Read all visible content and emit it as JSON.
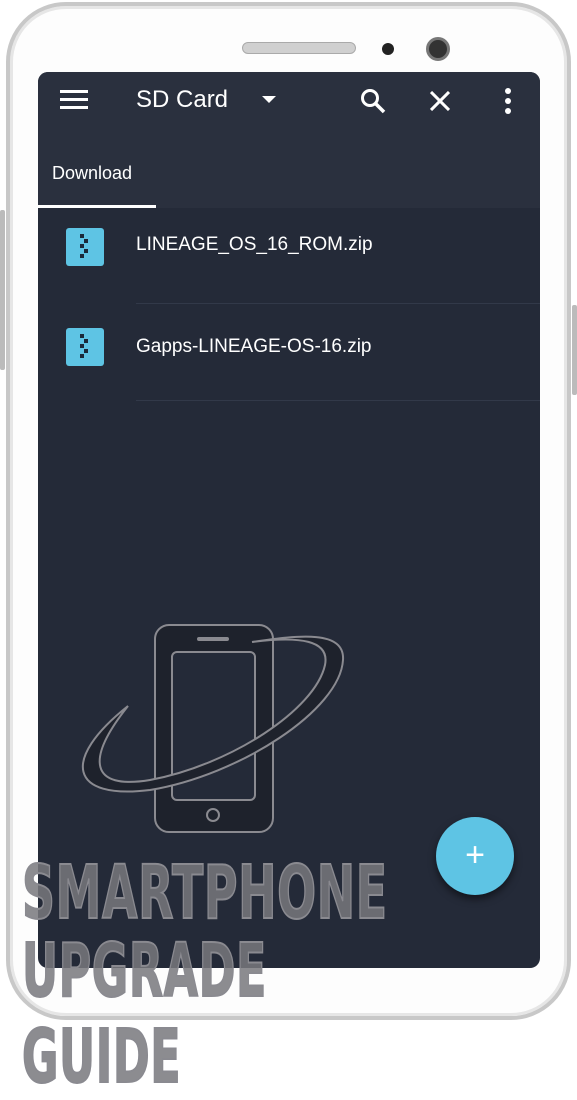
{
  "toolbar": {
    "title": "SD Card",
    "menu_icon": "hamburger-icon",
    "dropdown_icon": "caret-down-icon",
    "search_icon": "search-icon",
    "close_icon": "close-icon",
    "more_icon": "more-vert-icon"
  },
  "tabs": [
    {
      "label": "Download",
      "active": true
    }
  ],
  "files": [
    {
      "name": "LINEAGE_OS_16_ROM.zip",
      "icon": "zip-file-icon"
    },
    {
      "name": "Gapps-LINEAGE-OS-16.zip",
      "icon": "zip-file-icon"
    }
  ],
  "fab": {
    "label": "+",
    "icon": "plus-icon"
  },
  "watermark": {
    "line1": "SMARTPHONE",
    "line2": "UPGRADE GUIDE"
  },
  "colors": {
    "accent": "#5ec4e4",
    "toolbar": "#2a303e",
    "background": "#242a38"
  }
}
